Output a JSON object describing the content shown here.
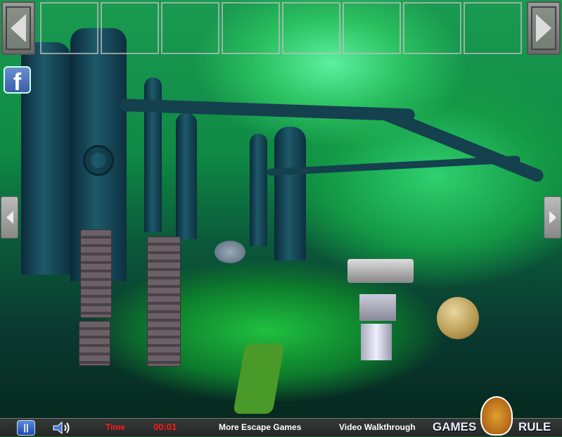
{
  "top_bar": {
    "prev_icon": "arrow-left-icon",
    "next_icon": "arrow-right-icon",
    "inventory_slots": [
      {},
      {},
      {},
      {},
      {},
      {},
      {},
      {}
    ]
  },
  "social": {
    "facebook_letter": "f",
    "icon": "facebook-icon"
  },
  "bottom_bar": {
    "pause_icon": "pause-icon",
    "sound_icon": "speaker-icon",
    "time_label": "Time",
    "time_value": "00:01",
    "more_games": "More Escape Games",
    "walkthrough": "Video Walkthrough",
    "logo_text_left": "GAMES",
    "logo_text_right": "RULE"
  },
  "colors": {
    "time": "#ff1a1a",
    "text": "#ffffff",
    "scene": "#0f8a45"
  }
}
